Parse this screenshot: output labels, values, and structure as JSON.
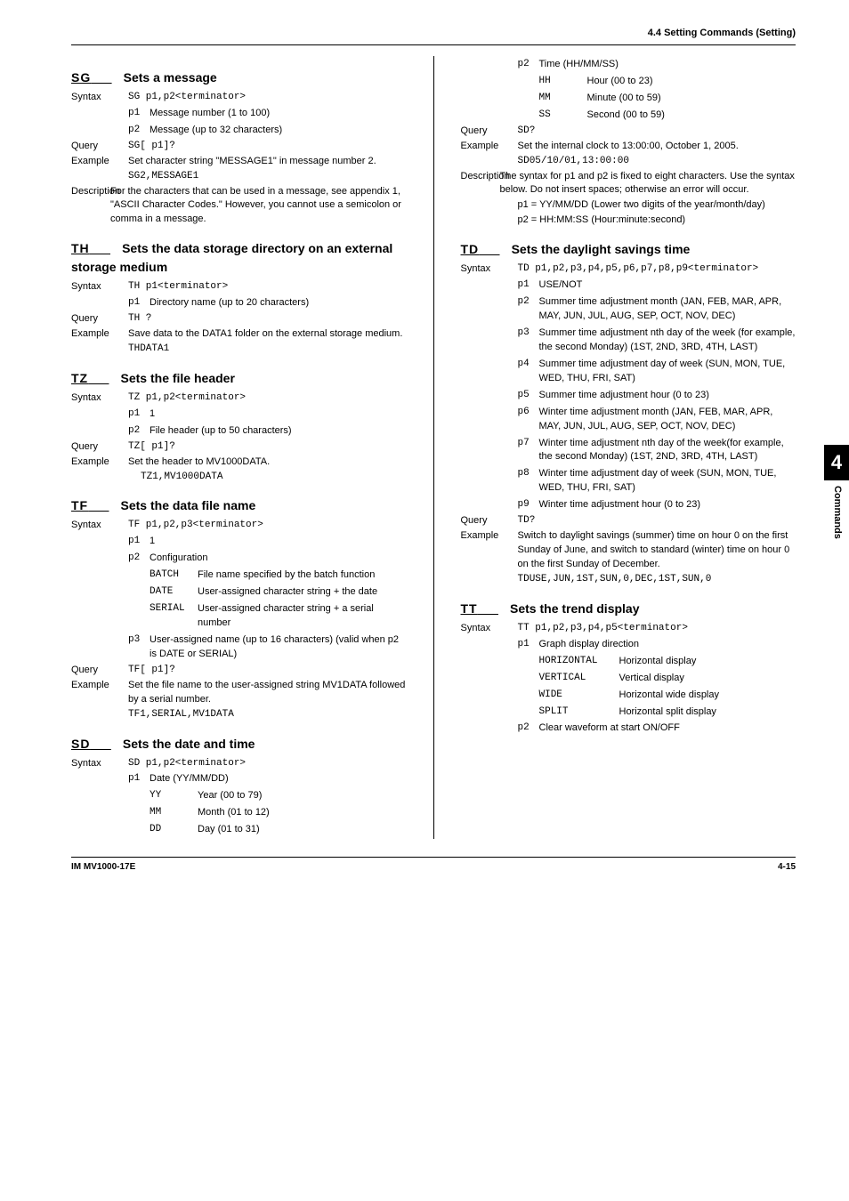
{
  "header": {
    "section": "4.4  Setting Commands (Setting)"
  },
  "side": {
    "num": "4",
    "label": "Commands"
  },
  "footer": {
    "left": "IM MV1000-17E",
    "right": "4-15"
  },
  "sg": {
    "code": "SG",
    "pad": "      ",
    "title": "Sets a message",
    "syntax_label": "Syntax",
    "syntax": "SG p1,p2<terminator>",
    "p1": {
      "code": "p1",
      "text": "Message number (1 to 100)"
    },
    "p2": {
      "code": "p2",
      "text": "Message (up to 32 characters)"
    },
    "query_label": "Query",
    "query": "SG[ p1]?",
    "example_label": "Example",
    "example_text": "Set character string \"MESSAGE1\" in message number 2.",
    "example_code": "SG2,MESSAGE1",
    "desc_label": "Description",
    "desc": " For the characters that can be used in a message, see appendix 1, \"ASCII Character Codes.\" However, you cannot use a semicolon or comma in a message."
  },
  "th": {
    "code": "TH",
    "pad": "      ",
    "title": "Sets the data storage directory on an external storage medium",
    "syntax_label": "Syntax",
    "syntax": "TH p1<terminator>",
    "p1": {
      "code": "p1",
      "text": "Directory name (up to 20 characters)"
    },
    "query_label": "Query",
    "query": "TH ?",
    "example_label": "Example",
    "example_text": "Save data to the DATA1 folder on the external storage medium.",
    "example_code": "THDATA1"
  },
  "tz": {
    "code": "TZ",
    "pad": "      ",
    "title": "Sets the file header",
    "syntax_label": "Syntax",
    "syntax": "TZ p1,p2<terminator>",
    "p1": {
      "code": "p1",
      "text": "1"
    },
    "p2": {
      "code": "p2",
      "text": "File header (up to 50 characters)"
    },
    "query_label": "Query",
    "query": "TZ[ p1]?",
    "example_label": "Example",
    "example_text": "Set the header to MV1000DATA.",
    "example_code": "TZ1,MV1000DATA"
  },
  "tf": {
    "code": "TF",
    "pad": "      ",
    "title": "Sets the data file name",
    "syntax_label": "Syntax",
    "syntax": "TF p1,p2,p3<terminator>",
    "p1": {
      "code": "p1",
      "text": "1"
    },
    "p2": {
      "code": "p2",
      "text": "Configuration"
    },
    "p2_batch": {
      "code": "BATCH",
      "text": "File name specified by the batch function"
    },
    "p2_date": {
      "code": "DATE",
      "text": "User-assigned character string + the date"
    },
    "p2_serial": {
      "code": "SERIAL",
      "text": "User-assigned character string + a serial number"
    },
    "p3": {
      "code": "p3",
      "text": "User-assigned name (up to 16 characters) (valid when p2 is DATE or SERIAL)"
    },
    "query_label": "Query",
    "query": "TF[ p1]?",
    "example_label": "Example",
    "example_text": "Set the file name to the user-assigned string MV1DATA followed by a serial number.",
    "example_code": "TF1,SERIAL,MV1DATA"
  },
  "sd": {
    "code": "SD",
    "pad": "      ",
    "title": "Sets the date and time",
    "syntax_label": "Syntax",
    "syntax": "SD p1,p2<terminator>",
    "p1": {
      "code": "p1",
      "text": "Date (YY/MM/DD)"
    },
    "p1_yy": {
      "code": "YY",
      "text": "Year (00 to 79)"
    },
    "p1_mm": {
      "code": "MM",
      "text": "Month (01 to 12)"
    },
    "p1_dd": {
      "code": "DD",
      "text": "Day (01 to 31)"
    },
    "p2": {
      "code": "p2",
      "text": "Time (HH/MM/SS)"
    },
    "p2_hh": {
      "code": "HH",
      "text": "Hour (00 to 23)"
    },
    "p2_mm": {
      "code": "MM",
      "text": "Minute (00 to 59)"
    },
    "p2_ss": {
      "code": "SS",
      "text": "Second (00 to 59)"
    },
    "query_label": "Query",
    "query": "SD?",
    "example_label": "Example",
    "example_text": "Set the internal clock to 13:00:00, October 1, 2005.",
    "example_code": "SD05/10/01,13:00:00",
    "desc_label": "Description",
    "desc": " The syntax for p1 and p2 is fixed to eight characters. Use the syntax below. Do not insert spaces; otherwise an error will occur.",
    "desc_p1": "p1 = YY/MM/DD (Lower two digits of the year/month/day)",
    "desc_p2": "p2 = HH:MM:SS (Hour:minute:second)"
  },
  "td": {
    "code": "TD",
    "pad": "      ",
    "title": "Sets the daylight savings time",
    "syntax_label": "Syntax",
    "syntax": "TD p1,p2,p3,p4,p5,p6,p7,p8,p9<terminator>",
    "p1": {
      "code": "p1",
      "text": "USE/NOT"
    },
    "p2": {
      "code": "p2",
      "text": "Summer time adjustment month (JAN, FEB, MAR, APR, MAY, JUN, JUL, AUG, SEP, OCT, NOV, DEC)"
    },
    "p3": {
      "code": "p3",
      "text": "Summer time adjustment nth day of the week (for example, the second Monday) (1ST, 2ND, 3RD, 4TH, LAST)"
    },
    "p4": {
      "code": "p4",
      "text": "Summer time adjustment day of week (SUN, MON, TUE, WED, THU, FRI, SAT)"
    },
    "p5": {
      "code": "p5",
      "text": "Summer time adjustment hour (0 to 23)"
    },
    "p6": {
      "code": "p6",
      "text": "Winter time adjustment month (JAN, FEB, MAR, APR, MAY, JUN, JUL, AUG, SEP, OCT, NOV, DEC)"
    },
    "p7": {
      "code": "p7",
      "text": "Winter time adjustment nth day of the week(for example, the second Monday) (1ST, 2ND, 3RD, 4TH, LAST)"
    },
    "p8": {
      "code": "p8",
      "text": "Winter time adjustment day of week (SUN, MON, TUE, WED, THU, FRI, SAT)"
    },
    "p9": {
      "code": "p9",
      "text": "Winter time adjustment hour (0 to 23)"
    },
    "query_label": "Query",
    "query": "TD?",
    "example_label": "Example",
    "example_text": "Switch to daylight savings (summer) time on hour 0 on the first Sunday of June, and switch to standard (winter) time on hour 0 on the first Sunday of December.",
    "example_code": "TDUSE,JUN,1ST,SUN,0,DEC,1ST,SUN,0"
  },
  "tt": {
    "code": "TT",
    "pad": "      ",
    "title": "Sets the trend display",
    "syntax_label": "Syntax",
    "syntax": "TT p1,p2,p3,p4,p5<terminator>",
    "p1": {
      "code": "p1",
      "text": "Graph display direction"
    },
    "p1_h": {
      "code": "HORIZONTAL",
      "text": "Horizontal display"
    },
    "p1_v": {
      "code": "VERTICAL",
      "text": "Vertical display"
    },
    "p1_w": {
      "code": "WIDE",
      "text": "Horizontal wide display"
    },
    "p1_s": {
      "code": "SPLIT",
      "text": "Horizontal split display"
    },
    "p2": {
      "code": "p2",
      "text": "Clear waveform at start ON/OFF"
    }
  }
}
